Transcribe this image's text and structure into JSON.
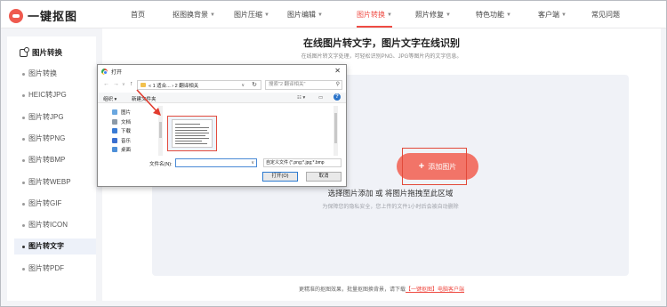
{
  "brand": {
    "name": "一键抠图",
    "accent": "#ef4b43"
  },
  "nav": {
    "items": [
      {
        "label": "首页",
        "caret": false,
        "active": false
      },
      {
        "label": "抠图换背景",
        "caret": true,
        "active": false
      },
      {
        "label": "图片压缩",
        "caret": true,
        "active": false
      },
      {
        "label": "图片编辑",
        "caret": true,
        "active": false
      },
      {
        "label": "图片转换",
        "caret": true,
        "active": true
      },
      {
        "label": "照片修复",
        "caret": true,
        "active": false
      },
      {
        "label": "特色功能",
        "caret": true,
        "active": false
      },
      {
        "label": "客户端",
        "caret": true,
        "active": false
      },
      {
        "label": "常见问题",
        "caret": false,
        "active": false
      }
    ]
  },
  "sidebar": {
    "heading": "图片转换",
    "items": [
      {
        "label": "图片转换",
        "active": false
      },
      {
        "label": "HEIC转JPG",
        "active": false
      },
      {
        "label": "图片转JPG",
        "active": false
      },
      {
        "label": "图片转PNG",
        "active": false
      },
      {
        "label": "图片转BMP",
        "active": false
      },
      {
        "label": "图片转WEBP",
        "active": false
      },
      {
        "label": "图片转GIF",
        "active": false
      },
      {
        "label": "图片转ICON",
        "active": false
      },
      {
        "label": "图片转文字",
        "active": true
      },
      {
        "label": "图片转PDF",
        "active": false
      }
    ]
  },
  "main": {
    "title": "在线图片转文字，图片文字在线识别",
    "subtitle": "在线图片转文字处理，可轻松识别PNG、JPG等图片内的文字信息。",
    "add_button": "添加图片",
    "drop_hint": "选择图片添加 或 将图片拖拽至此区域",
    "drop_note": "为保障您的隐私安全，您上传的文件1小时后会被自动删除",
    "footer_prefix": "更精准的抠图效果，批量抠图换背景，请下载",
    "footer_link": "【一键抠图】电脑客户端"
  },
  "dialog": {
    "title": "打开",
    "close": "✕",
    "address_path": "« 1 适合... › 2 翻译相关",
    "search_placeholder": "搜索\"2 翻译相关\"",
    "toolbar": {
      "organize": "组织 ▾",
      "new_folder": "新建文件夹"
    },
    "nav_items": [
      {
        "label": "图片",
        "color": "#6aa7e0"
      },
      {
        "label": "文档",
        "color": "#8c9aa8"
      },
      {
        "label": "下载",
        "color": "#3a7bd5"
      },
      {
        "label": "音乐",
        "color": "#3a6fd0"
      },
      {
        "label": "桌面",
        "color": "#4d8fd8"
      }
    ],
    "filename_label": "文件名(N):",
    "filetype_value": "自定义文件 (*.png;*.jpg;*.bmp",
    "open_button": "打开(O)",
    "cancel_button": "取消"
  }
}
